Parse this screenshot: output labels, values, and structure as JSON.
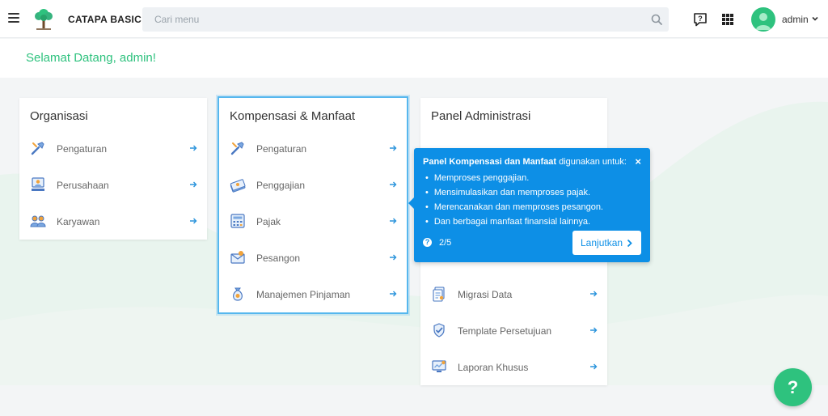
{
  "header": {
    "brand": "CATAPA BASIC",
    "search_placeholder": "Cari menu",
    "user_name": "admin"
  },
  "welcome": "Selamat Datang, admin!",
  "colors": {
    "accent": "#2ec27e",
    "primary_blue": "#0d8fe6",
    "selected_border": "#56b7ee"
  },
  "cards": {
    "organisasi": {
      "title": "Organisasi",
      "items": [
        {
          "label": "Pengaturan",
          "icon": "tools-icon"
        },
        {
          "label": "Perusahaan",
          "icon": "company-icon"
        },
        {
          "label": "Karyawan",
          "icon": "employees-icon"
        }
      ]
    },
    "kompensasi": {
      "title": "Kompensasi & Manfaat",
      "items": [
        {
          "label": "Pengaturan",
          "icon": "tools-icon"
        },
        {
          "label": "Penggajian",
          "icon": "payroll-icon"
        },
        {
          "label": "Pajak",
          "icon": "tax-calculator-icon"
        },
        {
          "label": "Pesangon",
          "icon": "severance-envelope-icon"
        },
        {
          "label": "Manajemen Pinjaman",
          "icon": "loan-bag-icon"
        }
      ]
    },
    "panel": {
      "title": "Panel Administrasi",
      "items": [
        {
          "label": "Migrasi Data",
          "icon": "data-migration-icon"
        },
        {
          "label": "Template Persetujuan",
          "icon": "approval-template-icon"
        },
        {
          "label": "Laporan Khusus",
          "icon": "custom-report-icon"
        }
      ]
    }
  },
  "tooltip": {
    "title_bold": "Panel Kompensasi dan Manfaat",
    "title_rest": " digunakan untuk:",
    "close": "×",
    "bullets": [
      "Memproses penggajian.",
      "Mensimulasikan dan memproses pajak.",
      "Merencanakan dan memproses pesangon.",
      "Dan berbagai manfaat finansial lainnya."
    ],
    "step": "2/5",
    "next_label": "Lanjutkan"
  },
  "fab": "?"
}
